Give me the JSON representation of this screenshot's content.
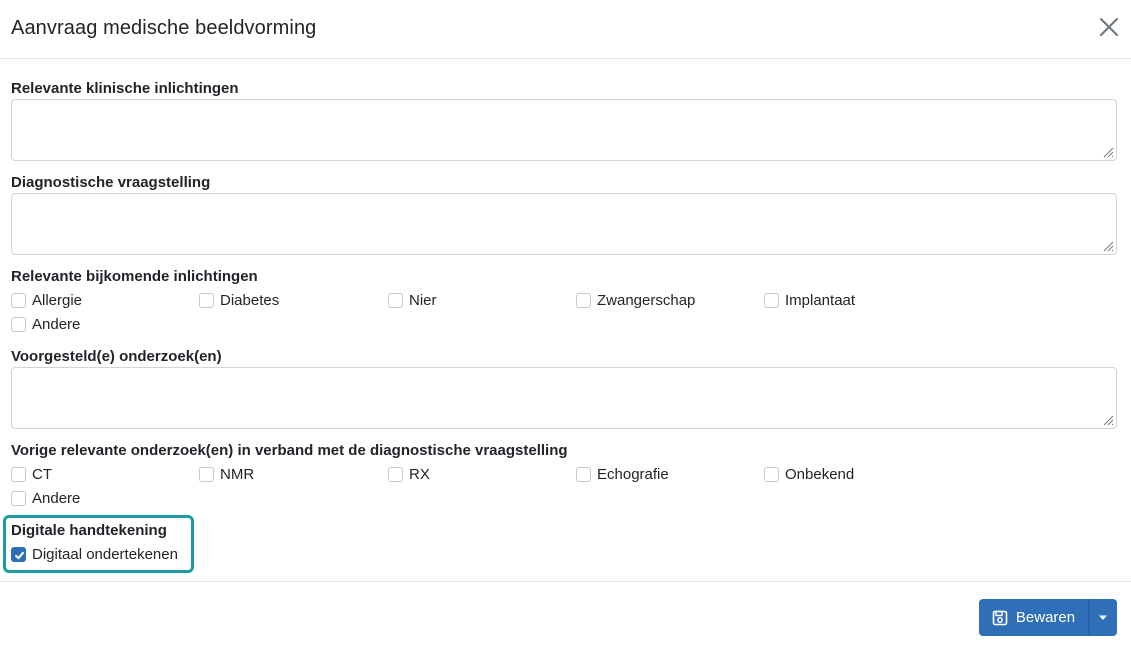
{
  "modal": {
    "title": "Aanvraag medische beeldvorming",
    "close_icon": "close-icon"
  },
  "fields": {
    "klinische": {
      "label": "Relevante klinische inlichtingen",
      "value": ""
    },
    "vraagstelling": {
      "label": "Diagnostische vraagstelling",
      "value": ""
    },
    "bijkomende": {
      "label": "Relevante bijkomende inlichtingen",
      "options": [
        {
          "label": "Allergie",
          "checked": false
        },
        {
          "label": "Diabetes",
          "checked": false
        },
        {
          "label": "Nier",
          "checked": false
        },
        {
          "label": "Zwangerschap",
          "checked": false
        },
        {
          "label": "Implantaat",
          "checked": false
        },
        {
          "label": "Andere",
          "checked": false
        }
      ]
    },
    "voorgesteld": {
      "label": "Voorgesteld(e) onderzoek(en)",
      "value": ""
    },
    "vorige": {
      "label": "Vorige relevante onderzoek(en) in verband met de diagnostische vraagstelling",
      "options": [
        {
          "label": "CT",
          "checked": false
        },
        {
          "label": "NMR",
          "checked": false
        },
        {
          "label": "RX",
          "checked": false
        },
        {
          "label": "Echografie",
          "checked": false
        },
        {
          "label": "Onbekend",
          "checked": false
        },
        {
          "label": "Andere",
          "checked": false
        }
      ]
    },
    "handtekening": {
      "label": "Digitale handtekening",
      "options": [
        {
          "label": "Digitaal ondertekenen",
          "checked": true
        }
      ]
    }
  },
  "footer": {
    "save_label": "Bewaren",
    "save_icon": "save-icon",
    "dropdown_icon": "caret-down-icon"
  },
  "colors": {
    "primary": "#2f6fb7",
    "highlight": "#1f9aa3",
    "border": "#ced4da"
  }
}
